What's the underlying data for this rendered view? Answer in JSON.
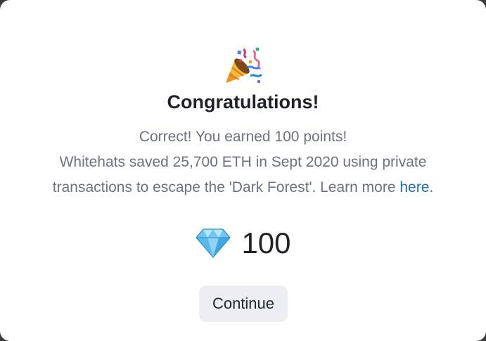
{
  "dialog": {
    "title": "Congratulations!",
    "message_line1": "Correct! You earned 100 points!",
    "message_line2": "Whitehats saved 25,700 ETH in Sept 2020 using private",
    "message_line3_pre": "transactions to escape the 'Dark Forest'. Learn more ",
    "message_link": "here",
    "message_line3_post": "."
  },
  "points": {
    "icon": "gem-icon",
    "value": "100"
  },
  "actions": {
    "continue_label": "Continue"
  },
  "icons": {
    "header": "party-popper-icon"
  },
  "colors": {
    "link": "#1e6fb8",
    "button_bg": "#eceef1",
    "gem": "#6ec6f2"
  }
}
